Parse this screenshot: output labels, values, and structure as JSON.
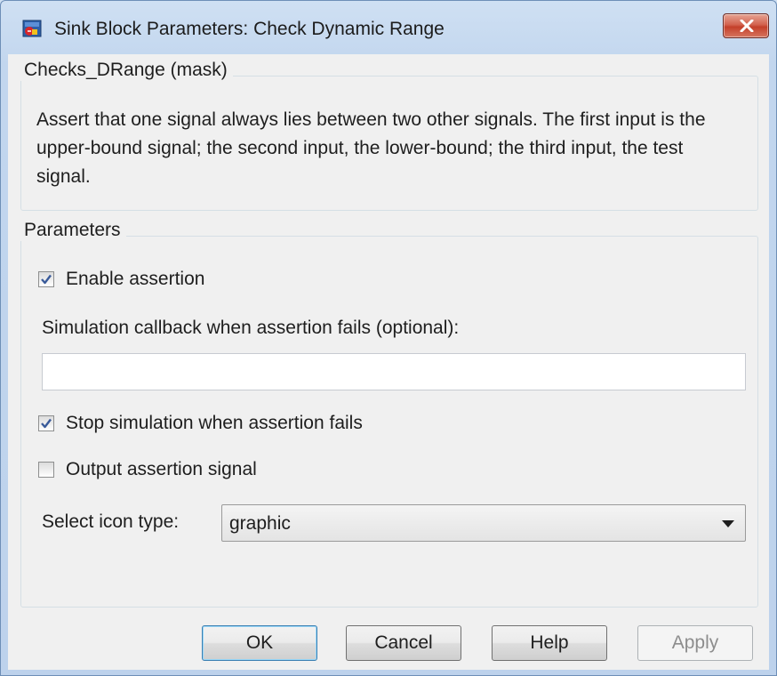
{
  "window": {
    "title": "Sink Block Parameters: Check Dynamic Range",
    "icon": "simulink-block-icon",
    "close_icon": "close-icon"
  },
  "description_group": {
    "legend": "Checks_DRange (mask)",
    "text": "Assert that one signal always lies between two other signals.  The first input is the upper-bound signal; the second input, the lower-bound; the third input, the test signal."
  },
  "parameters": {
    "legend": "Parameters",
    "enable_assertion": {
      "label": "Enable assertion",
      "checked": true
    },
    "callback": {
      "label": "Simulation callback when assertion fails (optional):",
      "value": ""
    },
    "stop_simulation": {
      "label": "Stop simulation when assertion fails",
      "checked": true
    },
    "output_signal": {
      "label": "Output assertion signal",
      "checked": false
    },
    "icon_type": {
      "label": "Select icon type:",
      "value": "graphic",
      "arrow_icon": "dropdown-arrow-icon"
    }
  },
  "buttons": {
    "ok": "OK",
    "cancel": "Cancel",
    "help": "Help",
    "apply": "Apply",
    "apply_enabled": false
  },
  "colors": {
    "title_bar": "#c2d6ee",
    "dialog_bg": "#f0f0f0",
    "close_button": "#c4402a",
    "check_mark": "#3a5b9a",
    "disabled_text": "#8d8d8d"
  }
}
